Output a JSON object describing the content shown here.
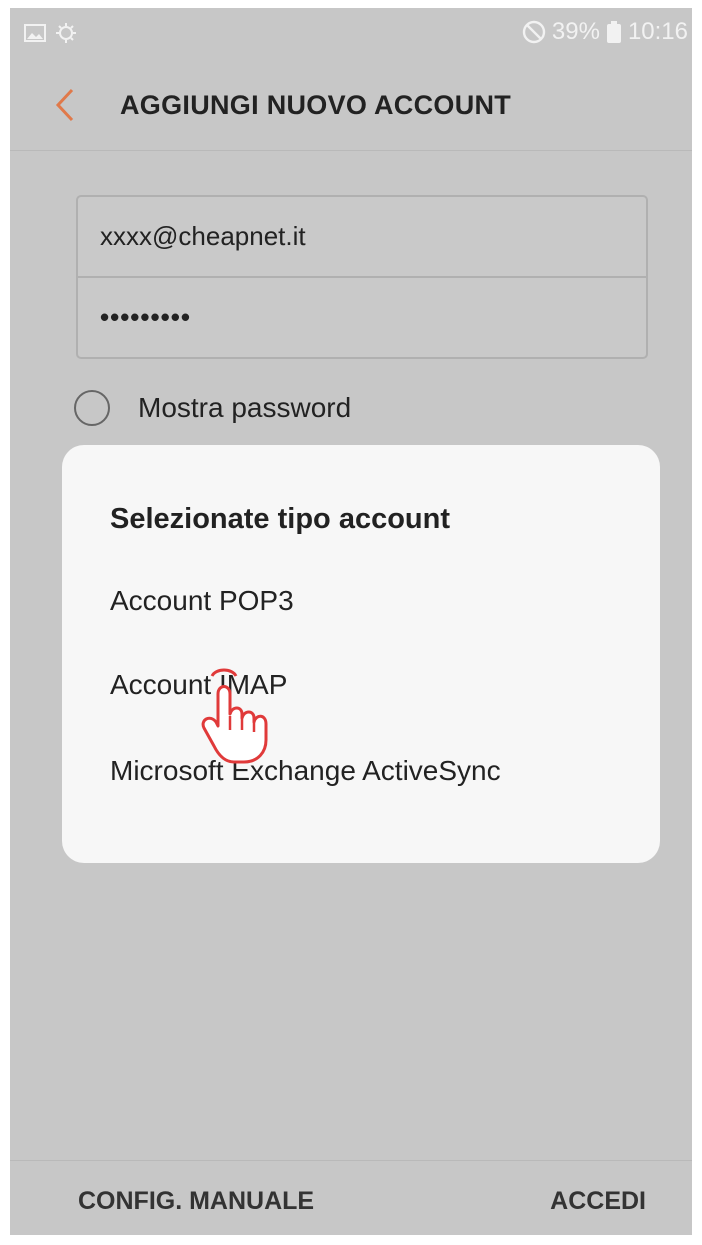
{
  "status_bar": {
    "battery": "39%",
    "time": "10:16",
    "icons": [
      "image-icon",
      "sync-icon",
      "do-not-disturb-icon",
      "battery-icon"
    ]
  },
  "app_bar": {
    "title": "AGGIUNGI NUOVO ACCOUNT",
    "back_icon": "chevron-left-icon",
    "accent_color": "#e0794a"
  },
  "form": {
    "email_value": "xxxx@cheapnet.it",
    "password_masked": "•••••••••",
    "show_password_label": "Mostra password"
  },
  "dialog": {
    "title": "Selezionate tipo account",
    "options": [
      "Account POP3",
      "Account IMAP",
      "Microsoft Exchange ActiveSync"
    ]
  },
  "bottom_bar": {
    "left_button": "CONFIG. MANUALE",
    "right_button": "ACCEDI"
  }
}
